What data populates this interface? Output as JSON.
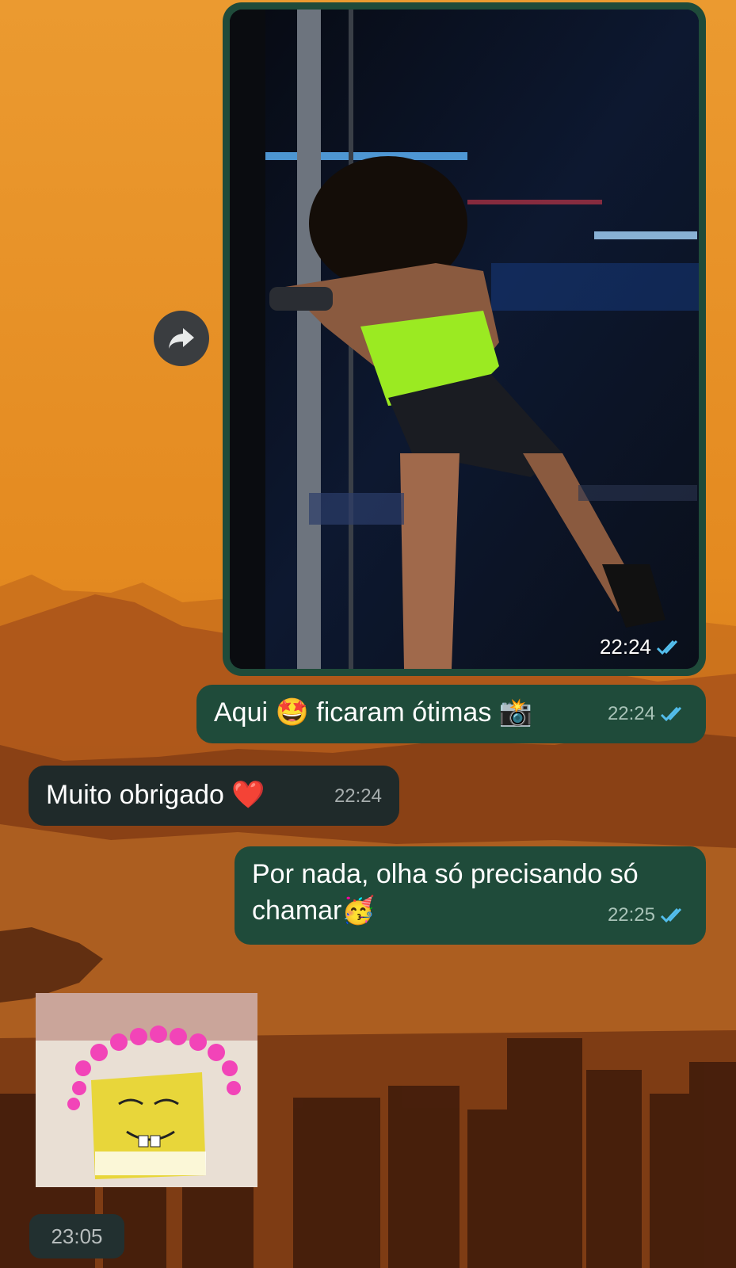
{
  "messages": {
    "photo": {
      "time": "22:24"
    },
    "msg1": {
      "text_a": "Aqui ",
      "emoji_a": "🤩",
      "text_b": " ficaram ótimas ",
      "emoji_b": "📸",
      "time": "22:24"
    },
    "msg2": {
      "text": "Muito obrigado ",
      "emoji": "❤️",
      "time": "22:24"
    },
    "msg3": {
      "line1": "Por nada, olha só precisando só",
      "line2": "chamar",
      "emoji": "🥳",
      "time": "22:25"
    },
    "sticker_time": "23:05"
  },
  "colors": {
    "outgoing_bubble": "#1f4b3a",
    "incoming_bubble": "#1f2a2a",
    "read_tick": "#53bdeb"
  },
  "icons": {
    "forward": "forward-arrow-icon",
    "read_receipt": "double-check-icon"
  }
}
